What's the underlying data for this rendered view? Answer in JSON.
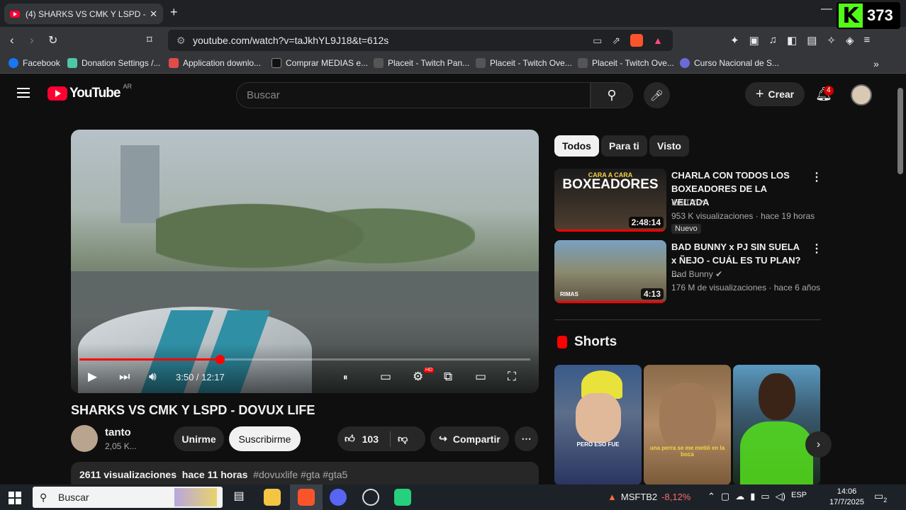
{
  "browser": {
    "tab_title": "(4) SHARKS VS CMK Y LSPD - DOVUX LIFE",
    "new_tab": "+",
    "url": "youtube.com/watch?v=taJkhYL9J18&t=612s",
    "kick_count": "373",
    "bookmarks": [
      "Facebook",
      "Donation Settings /...",
      "Application downlo...",
      "Comprar MEDIAS e...",
      "Placeit - Twitch Pan...",
      "Placeit - Twitch Ove...",
      "Placeit - Twitch Ove...",
      "Curso Nacional de S..."
    ]
  },
  "youtube": {
    "logo": "YouTube",
    "region": "AR",
    "search_placeholder": "Buscar",
    "create": "Crear",
    "notifications": "4",
    "video": {
      "time": "3:50 / 12:17",
      "progress": 0.312,
      "title": "SHARKS VS CMK Y LSPD - DOVUX LIFE",
      "channel": "tanto",
      "subscribers": "2,05 K...",
      "join": "Unirme",
      "subscribe": "Suscribirme",
      "likes": "103",
      "share": "Compartir",
      "views": "2611 visualizaciones",
      "date": "hace 11 horas",
      "tags": "#dovuxlife #gta #gta5"
    },
    "chips": [
      "Todos",
      "Para ti",
      "Visto"
    ],
    "recommendations": [
      {
        "thumb_text": "CARA A CARA",
        "thumb_big": "BOXEADORES",
        "title": "CHARLA CON TODOS LOS BOXEADORES DE LA VELADA",
        "channel": "IbaiTV",
        "meta": "953 K visualizaciones · hace 19 horas",
        "badge": "Nuevo",
        "duration": "2:48:14"
      },
      {
        "thumb_text": "RIMAS",
        "title": "BAD BUNNY x PJ SIN SUELA x ÑEJO - CUÁL ES TU PLAN? ...",
        "channel": "Bad Bunny",
        "meta": "176 M de visualizaciones · hace 6 años",
        "duration": "4:13"
      }
    ],
    "shorts_header": "Shorts",
    "shorts": [
      {
        "caption": "PERO ESO FUE"
      },
      {
        "caption": "una perra se me metió en la boca"
      },
      {
        "caption": ""
      }
    ]
  },
  "taskbar": {
    "search": "Buscar",
    "stock_name": "MSFTB2",
    "stock_change": "-8,12%",
    "lang": "ESP",
    "time": "14:06",
    "date": "17/7/2025",
    "notif_count": "2"
  }
}
